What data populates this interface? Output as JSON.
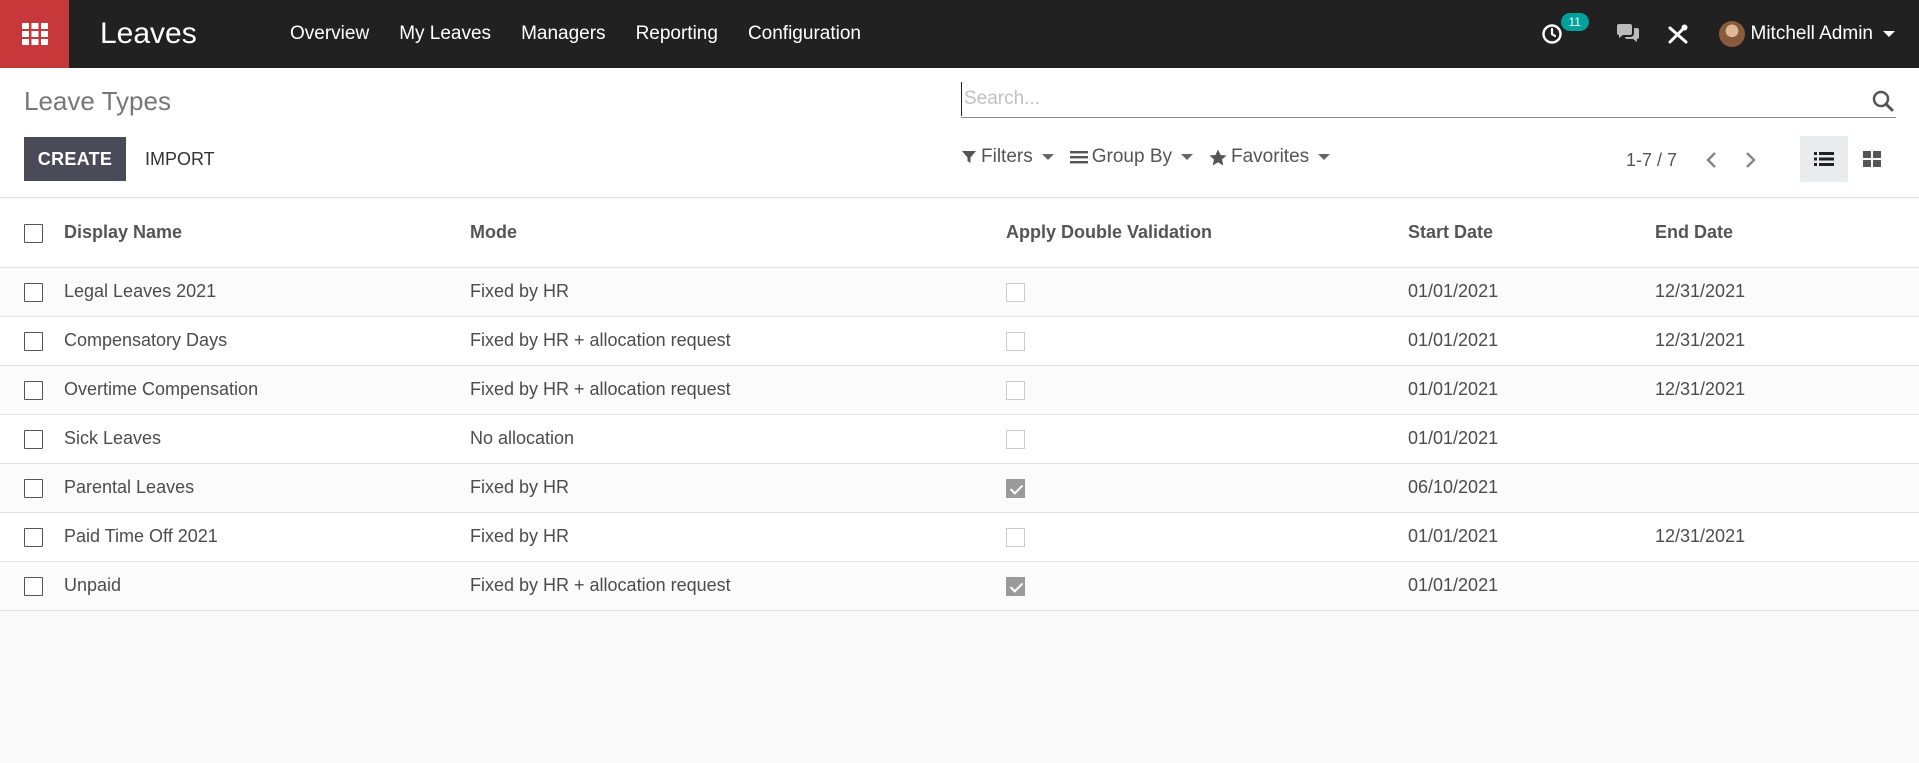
{
  "navbar": {
    "app_title": "Leaves",
    "menu": [
      "Overview",
      "My Leaves",
      "Managers",
      "Reporting",
      "Configuration"
    ],
    "activity_count": "11",
    "user_name": "Mitchell Admin",
    "accent_color": "#c7383a",
    "badge_color": "#00a09d"
  },
  "control_panel": {
    "breadcrumb": "Leave Types",
    "search_placeholder": "Search...",
    "create_label": "CREATE",
    "import_label": "IMPORT",
    "filters_label": "Filters",
    "group_by_label": "Group By",
    "favorites_label": "Favorites",
    "pager_value": "1-7 / 7",
    "active_view": "list"
  },
  "table": {
    "columns": [
      "Display Name",
      "Mode",
      "Apply Double Validation",
      "Start Date",
      "End Date"
    ],
    "rows": [
      {
        "name": "Legal Leaves 2021",
        "mode": "Fixed by HR",
        "double_validation": false,
        "start": "01/01/2021",
        "end": "12/31/2021"
      },
      {
        "name": "Compensatory Days",
        "mode": "Fixed by HR + allocation request",
        "double_validation": false,
        "start": "01/01/2021",
        "end": "12/31/2021"
      },
      {
        "name": "Overtime Compensation",
        "mode": "Fixed by HR + allocation request",
        "double_validation": false,
        "start": "01/01/2021",
        "end": "12/31/2021"
      },
      {
        "name": "Sick Leaves",
        "mode": "No allocation",
        "double_validation": false,
        "start": "01/01/2021",
        "end": ""
      },
      {
        "name": "Parental Leaves",
        "mode": "Fixed by HR",
        "double_validation": true,
        "start": "06/10/2021",
        "end": ""
      },
      {
        "name": "Paid Time Off 2021",
        "mode": "Fixed by HR",
        "double_validation": false,
        "start": "01/01/2021",
        "end": "12/31/2021"
      },
      {
        "name": "Unpaid",
        "mode": "Fixed by HR + allocation request",
        "double_validation": true,
        "start": "01/01/2021",
        "end": ""
      }
    ]
  }
}
